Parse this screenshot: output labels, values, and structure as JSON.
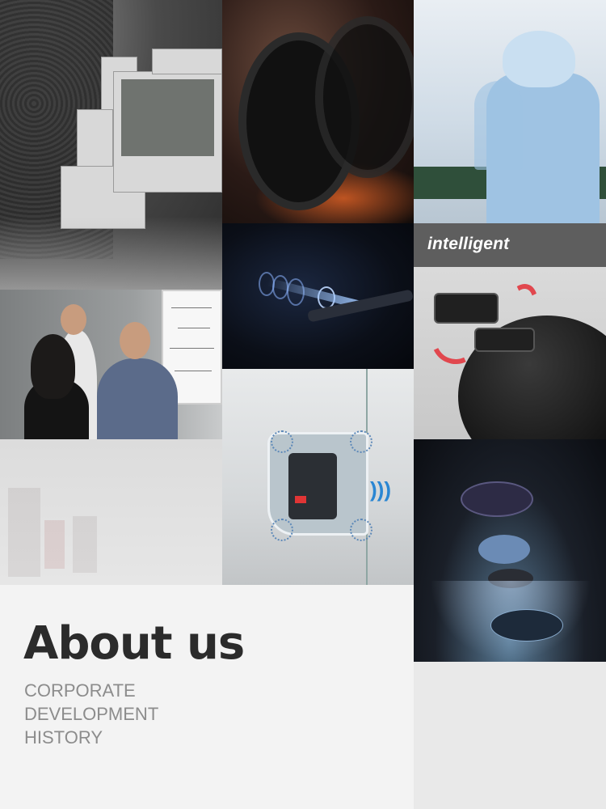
{
  "tiles": {
    "intelligent_label": "intelligent"
  },
  "about": {
    "title": "About us",
    "subtitle_lines": [
      "CORPORATE",
      "DEVELOPMENT",
      "HISTORY"
    ]
  },
  "colors": {
    "title": "#2b2b2b",
    "subtitle": "#8c8c8c",
    "band": "#5e5e5e",
    "accent_red": "#e1474e",
    "accent_blue": "#2a86d3"
  }
}
